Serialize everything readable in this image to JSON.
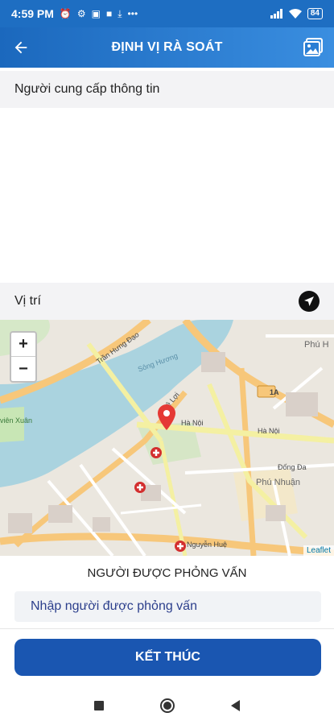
{
  "status_bar": {
    "time": "4:59 PM",
    "left_icons": [
      "alarm-icon",
      "settings-icon",
      "message-icon",
      "notification-icon",
      "download-icon",
      "more-icon"
    ],
    "right_icons": [
      "signal-icon",
      "wifi-icon"
    ],
    "battery": "84"
  },
  "app_bar": {
    "title": "ĐỊNH VỊ RÀ SOÁT",
    "back_icon": "arrow-left-icon",
    "action_icon": "gallery-icon"
  },
  "provider_section": {
    "label": "Người cung cấp thông tin"
  },
  "location_section": {
    "label": "Vị trí",
    "locate_icon": "navigation-arrow-icon"
  },
  "map": {
    "zoom_in": "+",
    "zoom_out": "−",
    "attribution": "Leaflet",
    "labels": {
      "river": "Sông Hương",
      "hanoi_1": "Hà Nội",
      "hanoi_2": "Hà Nội",
      "phu_nhuan": "Phú Nhuận",
      "phu_hoi": "Phú H",
      "tran_hung_dao": "Trần Hưng Đạo",
      "nguyen_hue": "Nguyễn Huệ",
      "le_loi": "Lê Lợi",
      "dong_da": "Đống Đa",
      "route": "1A",
      "vien_xuan": "viên Xuân"
    },
    "marker_icon": "map-pin-icon",
    "hospital_icon": "hospital-icon"
  },
  "interview": {
    "title": "NGƯỜI ĐƯỢC PHỎNG VẤN",
    "input_placeholder": "Nhập người được phỏng vấn"
  },
  "finish_button": {
    "label": "KẾT THÚC"
  },
  "nav_bar": {
    "icons": [
      "recents-icon",
      "home-icon",
      "back-icon"
    ]
  },
  "colors": {
    "primary": "#1a56b1",
    "app_bar": "#1e6ec2",
    "river": "#aad3df",
    "park": "#c8e6b5",
    "road_major": "#f7c77a",
    "road_yellow": "#f4f0a2",
    "marker": "#e53935"
  }
}
